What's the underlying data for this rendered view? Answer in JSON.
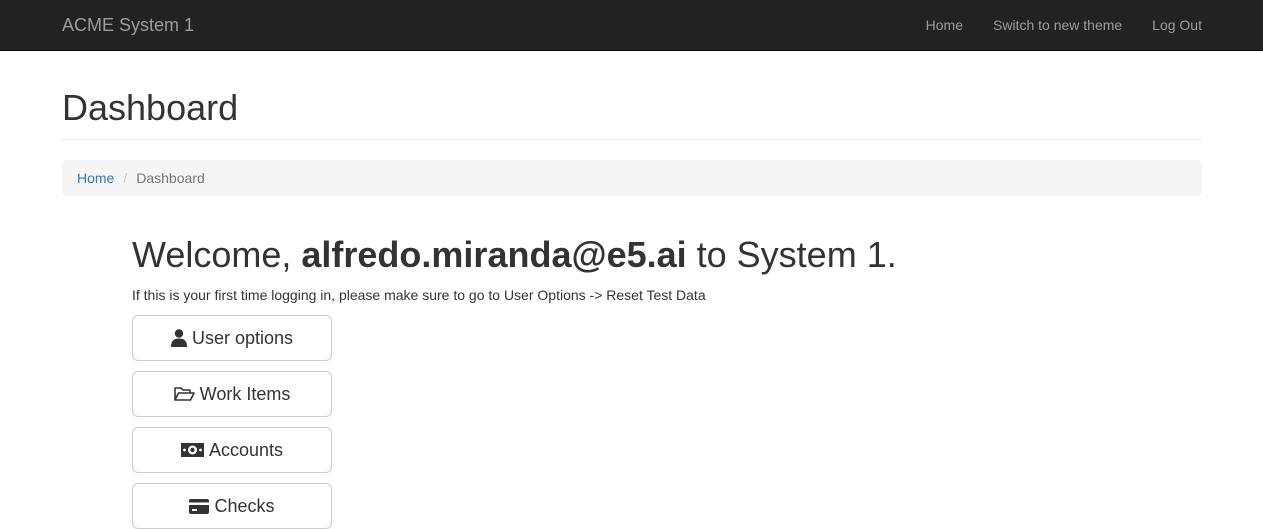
{
  "navbar": {
    "brand": "ACME System 1",
    "links": [
      {
        "label": "Home"
      },
      {
        "label": "Switch to new theme"
      },
      {
        "label": "Log Out"
      }
    ]
  },
  "page": {
    "title": "Dashboard"
  },
  "breadcrumb": {
    "home": "Home",
    "separator": "/",
    "current": "Dashboard"
  },
  "welcome": {
    "prefix": "Welcome, ",
    "user": "alfredo.miranda@e5.ai",
    "suffix": " to System 1.",
    "info": "If this is your first time logging in, please make sure to go to User Options -> Reset Test Data"
  },
  "buttons": [
    {
      "label": "User options",
      "icon": "user-icon"
    },
    {
      "label": "Work Items",
      "icon": "folder-open-icon"
    },
    {
      "label": "Accounts",
      "icon": "money-icon"
    },
    {
      "label": "Checks",
      "icon": "credit-card-icon"
    }
  ],
  "colors": {
    "navbar_bg": "#222222",
    "navbar_text": "#9d9d9d",
    "link": "#337ab7",
    "breadcrumb_bg": "#f5f5f5"
  }
}
